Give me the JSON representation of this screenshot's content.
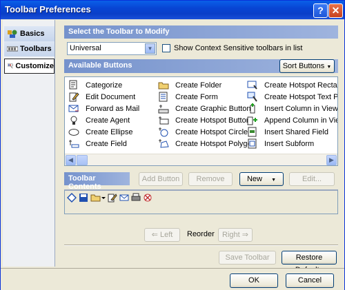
{
  "window": {
    "title": "Toolbar Preferences",
    "help_glyph": "?",
    "close_glyph": "✕"
  },
  "sidebar": {
    "items": [
      {
        "label": "Basics",
        "icon": "basics-icon"
      },
      {
        "label": "Toolbars",
        "icon": "toolbars-icon"
      },
      {
        "label": "Customize",
        "icon": "customize-icon",
        "selected": true
      }
    ]
  },
  "section_select": {
    "header": "Select the Toolbar to Modify",
    "selected_toolbar": "Universal",
    "checkbox_label": "Show Context Sensitive toolbars in list",
    "checkbox_checked": false
  },
  "section_available": {
    "header": "Available Buttons",
    "sort_label": "Sort Buttons",
    "columns": [
      [
        "Categorize",
        "Edit Document",
        "Forward as Mail",
        "Create Agent",
        "Create Ellipse",
        "Create Field"
      ],
      [
        "Create Folder",
        "Create Form",
        "Create Graphic Button",
        "Create Hotspot Button",
        "Create Hotspot Circle",
        "Create Hotspot Polygon"
      ],
      [
        "Create Hotspot Rectang",
        "Create Hotspot Text Pop",
        "Insert Column in View",
        "Append Column in View",
        "Insert Shared Field",
        "Insert Subform"
      ]
    ]
  },
  "section_contents": {
    "header": "Toolbar Contents",
    "add_label": "Add Button",
    "remove_label": "Remove",
    "new_label": "New",
    "edit_label": "Edit..."
  },
  "reorder": {
    "left_label": "Left",
    "label": "Reorder",
    "right_label": "Right"
  },
  "actions": {
    "save_label": "Save Toolbar",
    "restore_label": "Restore Defaults"
  },
  "footer": {
    "ok_label": "OK",
    "cancel_label": "Cancel"
  },
  "colors": {
    "title_bar": "#0a4fd8",
    "section_header": "#7592cc",
    "window_bg": "#ece9d8"
  }
}
